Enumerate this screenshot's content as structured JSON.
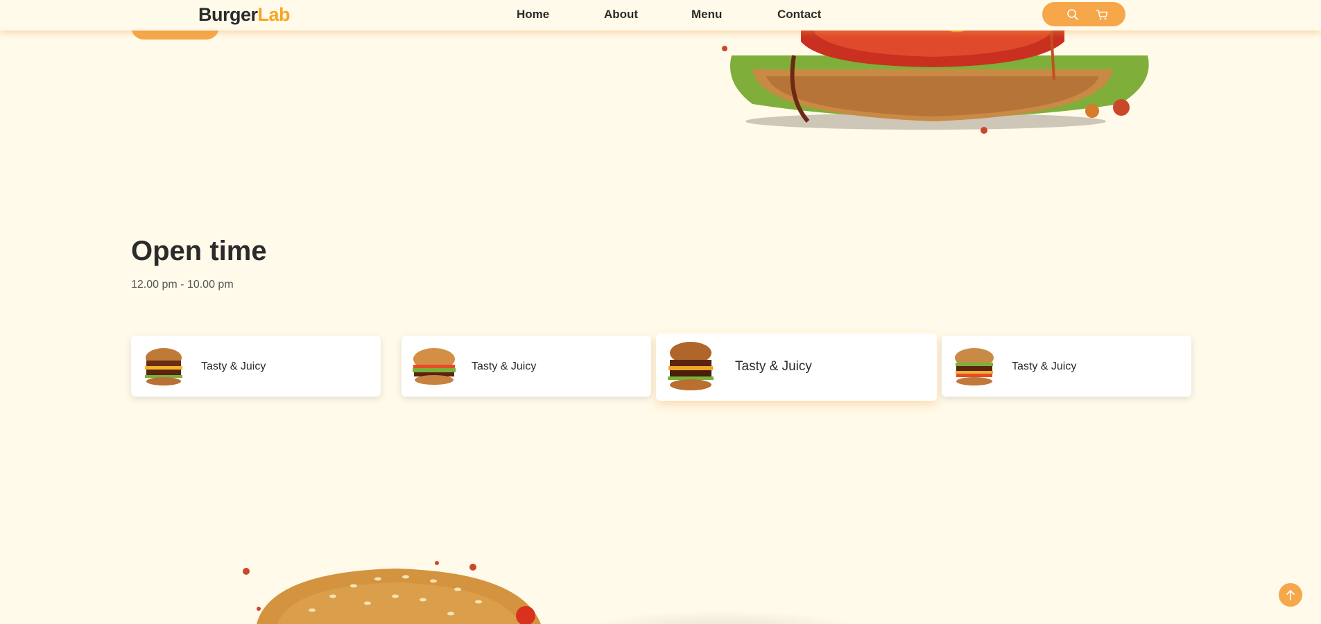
{
  "header": {
    "logo_part1": "Burger",
    "logo_part2": "Lab",
    "nav": [
      {
        "label": "Home"
      },
      {
        "label": "About"
      },
      {
        "label": "Menu"
      },
      {
        "label": "Contact"
      }
    ],
    "icons": [
      "search-icon",
      "cart-icon"
    ]
  },
  "open_time": {
    "title": "Open time",
    "hours": "12.00 pm - 10.00 pm"
  },
  "cards": [
    {
      "label": "Tasty & Juicy"
    },
    {
      "label": "Tasty & Juicy"
    },
    {
      "label": "Tasty & Juicy"
    },
    {
      "label": "Tasty & Juicy"
    }
  ],
  "colors": {
    "accent": "#f5a74a",
    "logo_accent": "#f5a623",
    "background": "#fffaea",
    "text": "#2b2b2b"
  }
}
